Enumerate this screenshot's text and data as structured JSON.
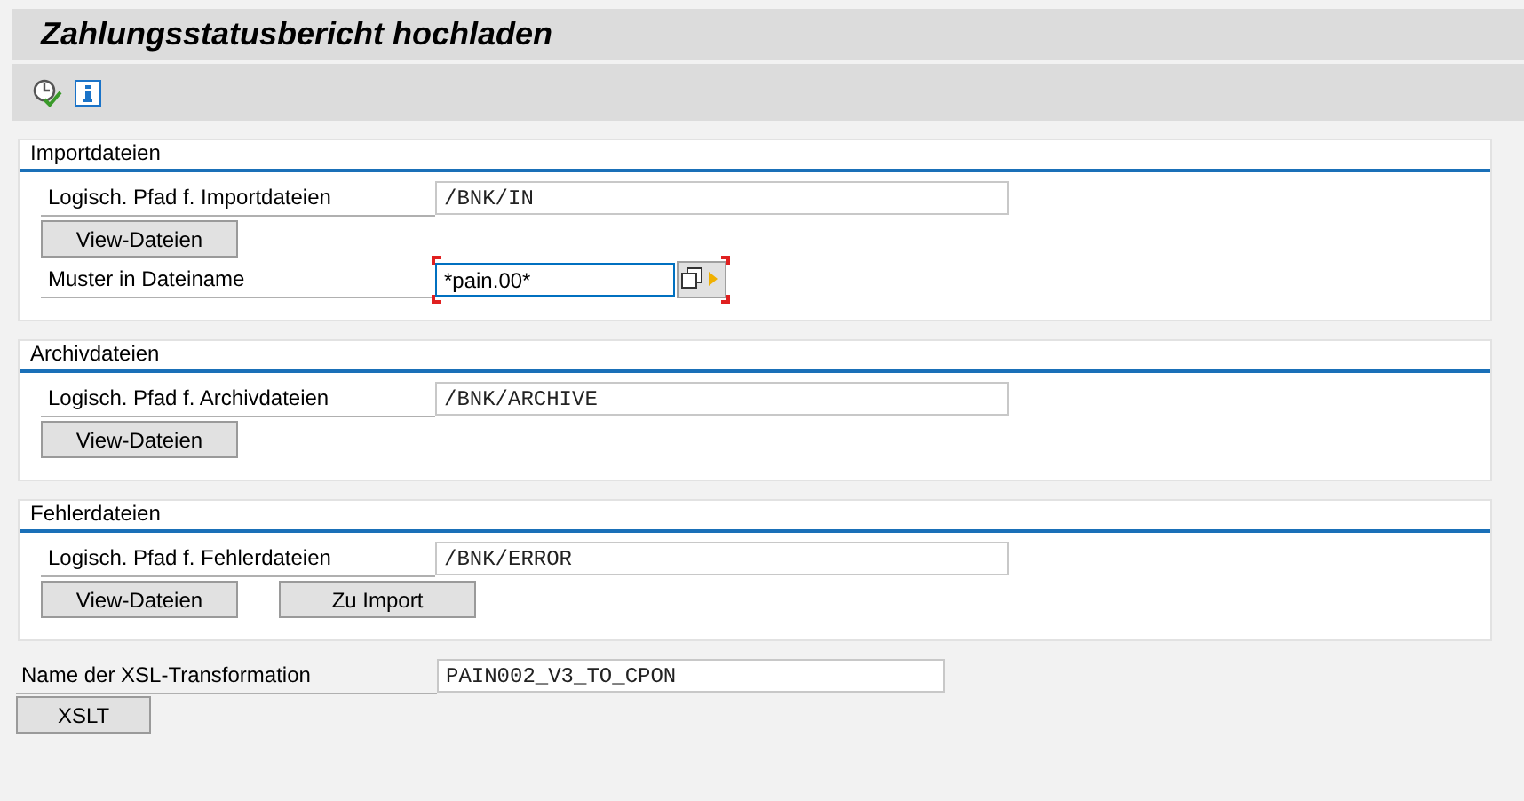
{
  "window": {
    "title": "Zahlungsstatusbericht hochladen"
  },
  "toolbar": [
    {
      "kind": "execute"
    },
    {
      "kind": "info"
    }
  ],
  "sections": [
    {
      "title": "Importdateien",
      "rows": [
        {
          "kind": "field",
          "label": "Logisch. Pfad f. Importdateien",
          "value": "/BNK/IN",
          "focused": false
        },
        {
          "kind": "buttons",
          "buttons": [
            "View-Dateien"
          ]
        },
        {
          "kind": "range_field",
          "label": "Muster in Dateiname",
          "value": "*pain.00*",
          "focused": true
        }
      ]
    },
    {
      "title": "Archivdateien",
      "rows": [
        {
          "kind": "field",
          "label": "Logisch. Pfad f. Archivdateien",
          "value": "/BNK/ARCHIVE",
          "focused": false
        },
        {
          "kind": "buttons",
          "buttons": [
            "View-Dateien"
          ]
        }
      ]
    },
    {
      "title": "Fehlerdateien",
      "rows": [
        {
          "kind": "field",
          "label": "Logisch. Pfad f. Fehlerdateien",
          "value": "/BNK/ERROR",
          "focused": false
        },
        {
          "kind": "buttons",
          "buttons": [
            "View-Dateien",
            "Zu Import"
          ]
        }
      ]
    }
  ],
  "xsl": {
    "label": "Name der XSL-Transformation",
    "value": "PAIN002_V3_TO_CPON",
    "button": "XSLT"
  }
}
